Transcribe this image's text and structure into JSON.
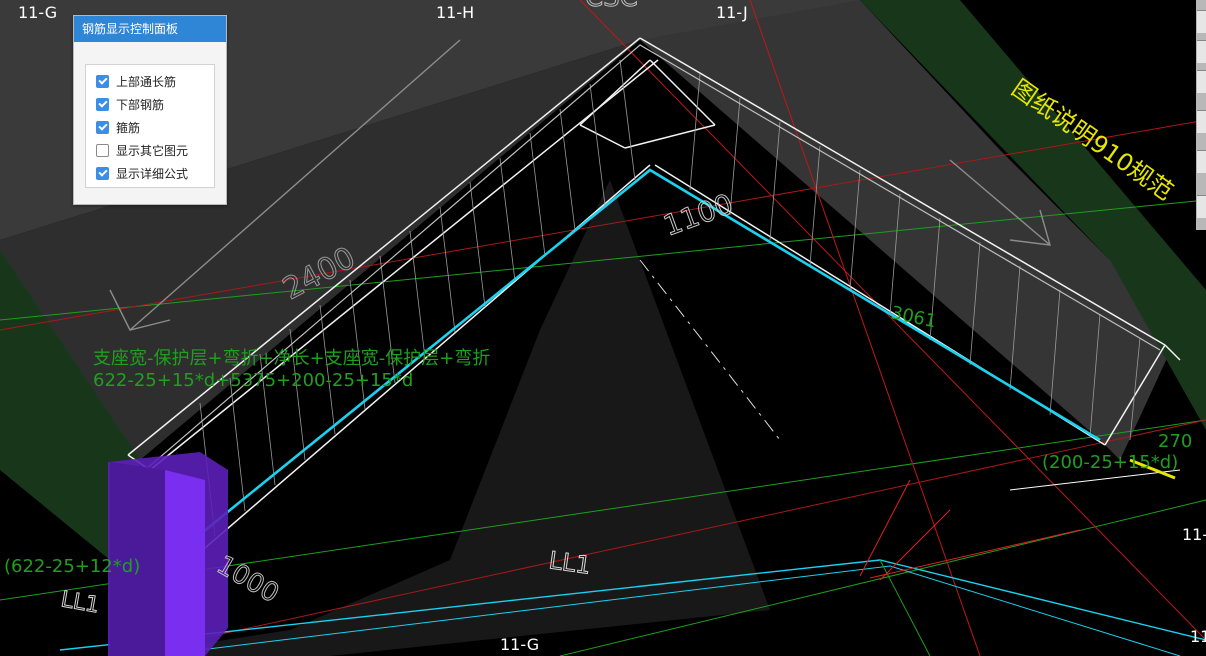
{
  "panel": {
    "title": "钢筋显示控制面板",
    "options": [
      {
        "label": "上部通长筋",
        "checked": true
      },
      {
        "label": "下部钢筋",
        "checked": true
      },
      {
        "label": "箍筋",
        "checked": true
      },
      {
        "label": "显示其它图元",
        "checked": false
      },
      {
        "label": "显示详细公式",
        "checked": true
      }
    ]
  },
  "axis_labels": {
    "g_top": "11-G",
    "h_top": "11-H",
    "j_top": "11-J",
    "g_bottom": "11-G",
    "right_mid": "11-",
    "right_bottom": "11"
  },
  "dimensions": {
    "d2400": "2400",
    "d1100": "1100",
    "d3061": "3061",
    "d1000": "1000",
    "d270": "270",
    "top_partial": "CSC"
  },
  "formulas": {
    "line1": "支座宽-保护层+弯折+净长+支座宽-保护层+弯折",
    "line2": "622-25+15*d+5375+200-25+15*d",
    "right_bracket": "(200-25+15*d)",
    "left_bracket": "(622-25+12*d)"
  },
  "beam_labels": {
    "ll1_mid": "LL1",
    "ll1_left": "LL1"
  },
  "annotation_text": "图纸说明910规范",
  "colors": {
    "rebar_cyan": "#19d2f0",
    "label_green": "#1f9f1f",
    "panel_header": "#2f86d7",
    "yellow_text": "#e6e600",
    "column_purple": "#6a22d6"
  }
}
